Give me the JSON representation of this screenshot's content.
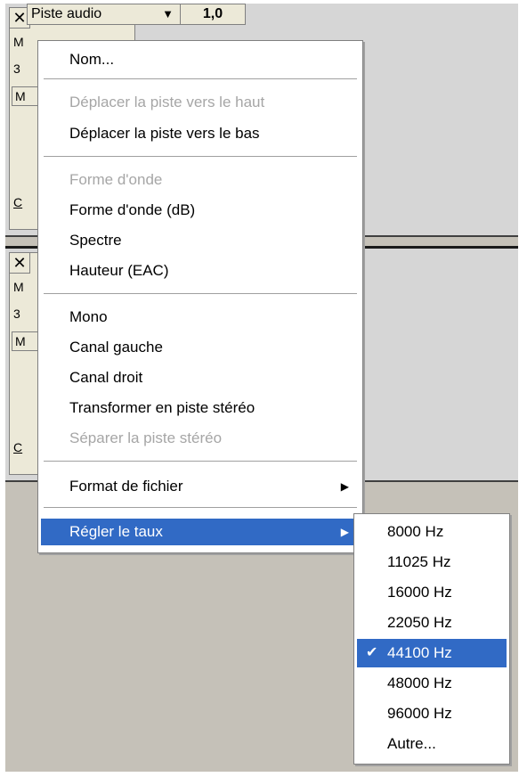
{
  "track": {
    "close_glyph": "✕",
    "name": "Piste audio",
    "caret": "▼",
    "rate": "1,0",
    "side_letters": [
      "M",
      "3",
      "M",
      "C"
    ]
  },
  "menu": {
    "items": [
      {
        "label": "Nom...",
        "enabled": true
      },
      {
        "label": "Déplacer la piste vers le haut",
        "enabled": false
      },
      {
        "label": "Déplacer la piste vers le bas",
        "enabled": true
      },
      {
        "label": "Forme d'onde",
        "enabled": false
      },
      {
        "label": "Forme d'onde (dB)",
        "enabled": true
      },
      {
        "label": "Spectre",
        "enabled": true
      },
      {
        "label": "Hauteur (EAC)",
        "enabled": true
      },
      {
        "label": "Mono",
        "enabled": true
      },
      {
        "label": "Canal gauche",
        "enabled": true
      },
      {
        "label": "Canal droit",
        "enabled": true
      },
      {
        "label": "Transformer en piste stéréo",
        "enabled": true
      },
      {
        "label": "Séparer la piste stéréo",
        "enabled": false
      },
      {
        "label": "Format de fichier",
        "enabled": true,
        "submenu": true
      },
      {
        "label": "Régler le taux",
        "enabled": true,
        "submenu": true,
        "selected": true
      }
    ],
    "submenu_arrow": "▶"
  },
  "submenu": {
    "items": [
      {
        "label": "8000 Hz"
      },
      {
        "label": "11025 Hz"
      },
      {
        "label": "16000 Hz"
      },
      {
        "label": "22050 Hz"
      },
      {
        "label": "44100 Hz",
        "checked": true
      },
      {
        "label": "48000 Hz"
      },
      {
        "label": "96000 Hz"
      },
      {
        "label": "Autre..."
      }
    ],
    "check_glyph": "✔"
  },
  "colors": {
    "selection": "#316ac5",
    "disabled_text": "#a6a6a6"
  }
}
